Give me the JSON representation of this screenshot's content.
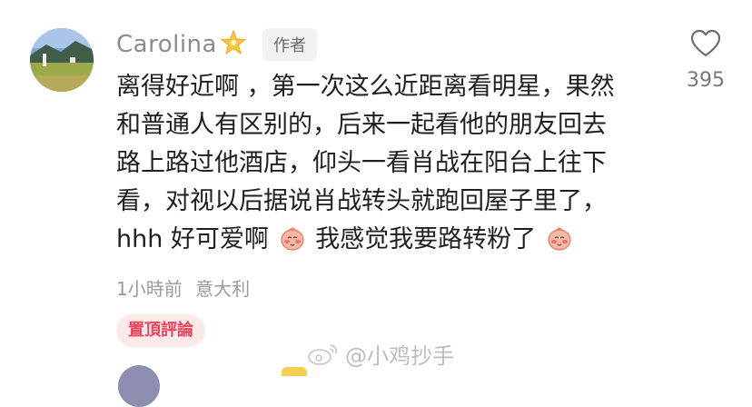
{
  "comment": {
    "username": "Carolina",
    "author_badge": "作者",
    "lines": [
      "离得好近啊 ，第一次这么近距离看明星，果然",
      "和普通人有区别的，后来一起看他的朋友回去",
      "路上路过他酒店，仰头一看肖战在阳台上往下",
      "看，对视以后据说肖战转头就跑回屋子里了，"
    ],
    "last_line_parts": [
      "hhh 好可爱啊",
      "我感觉我要路转粉了"
    ],
    "time": "1小時前",
    "location": "意大利",
    "pinned_label": "置頂評論",
    "like_count": "395"
  },
  "watermark": "@小鸡抄手",
  "icons": {
    "avatar": "landscape-avatar",
    "badge": "star-badge-icon",
    "emoji": "blushing-face-emoji",
    "like": "heart-outline-icon",
    "watermark": "weibo-logo-icon"
  },
  "colors": {
    "pinned_bg": "#fde8ea",
    "pinned_text": "#e8455b",
    "muted_text": "#9b9b9b"
  }
}
